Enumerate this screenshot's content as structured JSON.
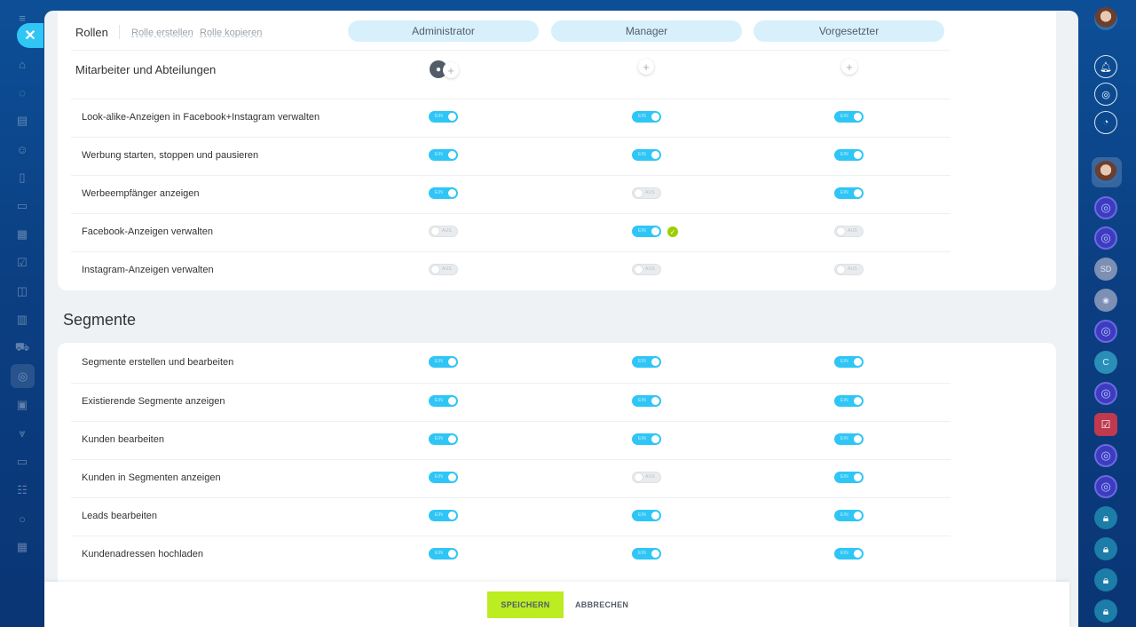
{
  "left_rail": {
    "icons": [
      "menu-icon",
      "home-icon",
      "feed-icon",
      "tasks-icon",
      "contacts-icon",
      "docs-icon",
      "crm-icon",
      "board-icon",
      "checklist-icon",
      "chat-icon",
      "analytics-icon",
      "shop-icon",
      "marketing-icon",
      "sites-icon",
      "filter-icon",
      "presentation-icon",
      "employees-icon",
      "globe-icon",
      "grid-icon"
    ]
  },
  "header": {
    "roles_label": "Rollen",
    "create_role": "Rolle erstellen",
    "copy_role": "Rolle kopieren",
    "columns": [
      "Administrator",
      "Manager",
      "Vorgesetzter"
    ]
  },
  "employees_label": "Mitarbeiter und Abteilungen",
  "toggle_on_text": "EIN",
  "toggle_off_text": "AUS",
  "top_rows": [
    {
      "label": "Look-alike-Anzeigen in Facebook+Instagram verwalten",
      "values": [
        true,
        true,
        true
      ]
    },
    {
      "label": "Werbung starten, stoppen und pausieren",
      "values": [
        true,
        true,
        true
      ]
    },
    {
      "label": "Werbeempfänger anzeigen",
      "values": [
        true,
        false,
        true
      ]
    },
    {
      "label": "Facebook-Anzeigen verwalten",
      "values": [
        false,
        true,
        false
      ]
    },
    {
      "label": "Instagram-Anzeigen verwalten",
      "values": [
        false,
        false,
        false
      ]
    }
  ],
  "segments": {
    "title": "Segmente",
    "rows": [
      {
        "label": "Segmente erstellen und bearbeiten",
        "values": [
          true,
          true,
          true
        ]
      },
      {
        "label": "Existierende Segmente anzeigen",
        "values": [
          true,
          true,
          true
        ]
      },
      {
        "label": "Kunden bearbeiten",
        "values": [
          true,
          true,
          true
        ]
      },
      {
        "label": "Kunden in Segmenten anzeigen",
        "values": [
          true,
          false,
          true
        ]
      },
      {
        "label": "Leads bearbeiten",
        "values": [
          true,
          true,
          true
        ]
      },
      {
        "label": "Kundenadressen hochladen",
        "values": [
          true,
          true,
          true
        ]
      }
    ]
  },
  "footer": {
    "save": "SPEICHERN",
    "cancel": "ABBRECHEN"
  },
  "right_rail": {
    "items": [
      "avatar",
      "notifications-icon",
      "open-channel-icon",
      "chat-search-icon",
      "avatar",
      "open-channel-icon",
      "open-channel-icon",
      "SD",
      "avatar",
      "open-channel-icon",
      "C",
      "open-channel-icon",
      "task-icon",
      "open-channel-icon",
      "open-channel-icon",
      "lock-icon",
      "lock-icon",
      "lock-icon",
      "lock-icon"
    ],
    "initials_sd": "SD",
    "initials_c": "C"
  },
  "colors": {
    "accent": "#2fc6f6",
    "save": "#bbed21",
    "header_pill": "#d7f0fb",
    "success": "#9dcf00"
  }
}
